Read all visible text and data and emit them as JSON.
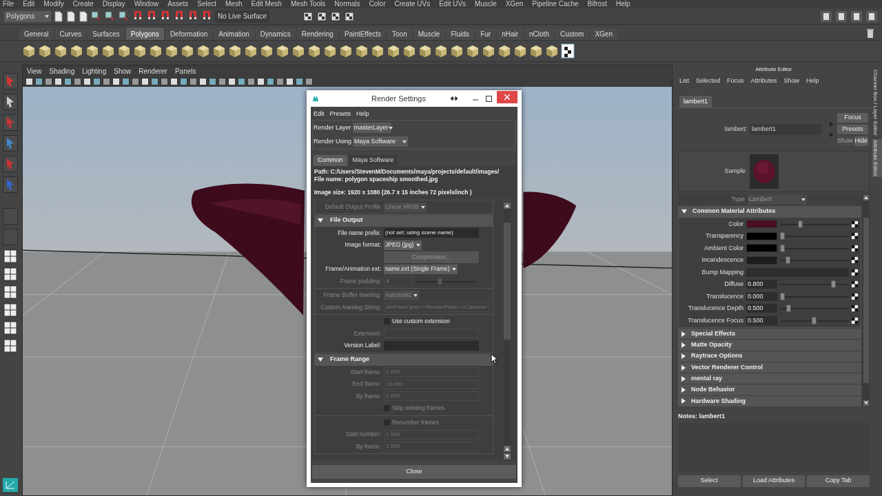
{
  "main_menu": [
    "File",
    "Edit",
    "Modify",
    "Create",
    "Display",
    "Window",
    "Assets",
    "Select",
    "Mesh",
    "Edit Mesh",
    "Mesh Tools",
    "Normals",
    "Color",
    "Create UVs",
    "Edit UVs",
    "Muscle",
    "XGen",
    "Pipeline Cache",
    "Bifrost",
    "Help"
  ],
  "status_line": {
    "menu_set": "Polygons",
    "live_surface": "No Live Surface"
  },
  "shelf_tabs": [
    {
      "label": "General",
      "selected": false
    },
    {
      "label": "Curves",
      "selected": false
    },
    {
      "label": "Surfaces",
      "selected": false
    },
    {
      "label": "Polygons",
      "selected": true
    },
    {
      "label": "Deformation",
      "selected": false
    },
    {
      "label": "Animation",
      "selected": false
    },
    {
      "label": "Dynamics",
      "selected": false
    },
    {
      "label": "Rendering",
      "selected": false
    },
    {
      "label": "PaintEffects",
      "selected": false
    },
    {
      "label": "Toon",
      "selected": false
    },
    {
      "label": "Muscle",
      "selected": false
    },
    {
      "label": "Fluids",
      "selected": false
    },
    {
      "label": "Fur",
      "selected": false
    },
    {
      "label": "nHair",
      "selected": false
    },
    {
      "label": "nCloth",
      "selected": false
    },
    {
      "label": "Custom",
      "selected": false
    },
    {
      "label": "XGen",
      "selected": false
    }
  ],
  "viewport": {
    "menu": [
      "View",
      "Shading",
      "Lighting",
      "Show",
      "Renderer",
      "Panels"
    ]
  },
  "render_settings": {
    "title": "Render Settings",
    "menu": [
      "Edit",
      "Presets",
      "Help"
    ],
    "render_layer": {
      "label": "Render Layer",
      "value": "masterLayer"
    },
    "render_using": {
      "label": "Render Using",
      "value": "Maya Software"
    },
    "tabs": [
      {
        "label": "Common",
        "selected": true
      },
      {
        "label": "Maya Software",
        "selected": false
      }
    ],
    "info": [
      "Path: C:/Users/StevenM/Documents/maya/projects/default/images/",
      "File name:  polygon spaceship smoothed.jpg",
      "Image size: 1920 x 1080 (26.7 x 15 inches 72 pixels/inch )"
    ],
    "top_rows": [
      {
        "kind": "dropdown",
        "label": "Default Output Profile",
        "value": "Linear sRGB",
        "disabled": true
      }
    ],
    "sections": [
      {
        "title": "File Output",
        "expanded": true,
        "groups": [
          [
            {
              "kind": "field",
              "label": "File name prefix:",
              "value": "(not set; using scene name)",
              "disabled": false
            },
            {
              "kind": "dropdown",
              "label": "Image format:",
              "value": "JPEG (jpg)",
              "disabled": false
            },
            {
              "kind": "button",
              "value": "Compression...",
              "disabled": true
            },
            {
              "kind": "dropdown",
              "label": "Frame/Animation ext:",
              "value": "name.ext (Single Frame)",
              "disabled": false
            },
            {
              "kind": "slider",
              "label": "Frame padding:",
              "value": "4",
              "level": 0.4,
              "disabled": true
            }
          ],
          [
            {
              "kind": "dropdown",
              "label": "Frame Buffer Naming:",
              "value": "Automatic",
              "disabled": true
            },
            {
              "kind": "field",
              "label": "Custom Naming String:",
              "value": "derPassType>:<RenderPass>.<Camera>",
              "disabled": true
            }
          ],
          [
            {
              "kind": "checkbox",
              "value": "Use custom extension",
              "checked": false,
              "disabled": false
            },
            {
              "kind": "field",
              "label": "Extension:",
              "disabled": true
            },
            {
              "kind": "field",
              "label": "Version Label:",
              "disabled": false
            }
          ]
        ]
      },
      {
        "title": "Frame Range",
        "expanded": true,
        "groups": [
          [
            {
              "kind": "field",
              "label": "Start frame:",
              "value": "1.000",
              "disabled": true
            },
            {
              "kind": "field",
              "label": "End frame:",
              "value": "10.000",
              "disabled": true
            },
            {
              "kind": "field",
              "label": "By frame:",
              "value": "1.000",
              "disabled": true
            },
            {
              "kind": "checkbox",
              "value": "Skip existing frames",
              "checked": false,
              "disabled": true
            }
          ],
          [
            {
              "kind": "checkbox",
              "value": "Renumber frames",
              "checked": false,
              "disabled": true
            },
            {
              "kind": "field",
              "label": "Start number:",
              "value": "1.000",
              "disabled": true
            },
            {
              "kind": "field",
              "label": "By frame:",
              "value": "1.000",
              "disabled": true
            }
          ]
        ]
      }
    ],
    "close": "Close"
  },
  "attribute_editor": {
    "title": "Attribute Editor",
    "menu": [
      "List",
      "Selected",
      "Focus",
      "Attributes",
      "Show",
      "Help"
    ],
    "tabs": [
      {
        "label": "lambert1",
        "selected": true
      }
    ],
    "node": {
      "label": "lambert:",
      "value": "lambert1"
    },
    "buttons": [
      {
        "label": "Focus",
        "disabled": false
      },
      {
        "label": "Presets",
        "disabled": false
      }
    ],
    "show_hide": [
      {
        "label": "Show",
        "disabled": true
      },
      {
        "label": "Hide",
        "disabled": false
      }
    ],
    "sample_label": "Sample",
    "type": {
      "label": "Type",
      "value": "Lambert"
    },
    "sections": [
      {
        "title": "Common Material Attributes",
        "expanded": true,
        "attributes": [
          {
            "kind": "color",
            "label": "Color",
            "color": "#4a0f22",
            "level": 0.29
          },
          {
            "kind": "color",
            "label": "Transparency",
            "color": "#000000",
            "level": 0.03
          },
          {
            "kind": "color",
            "label": "Ambient Color",
            "color": "#000000",
            "level": 0.03
          },
          {
            "kind": "color",
            "label": "Incandescence",
            "color": "#1c1c1c",
            "level": 0.11
          },
          {
            "kind": "map",
            "label": "Bump Mapping"
          },
          {
            "kind": "number",
            "label": "Diffuse",
            "value": "0.800",
            "level": 0.77
          },
          {
            "kind": "number",
            "label": "Translucence",
            "value": "0.000",
            "level": 0.03
          },
          {
            "kind": "number",
            "label": "Translucence Depth",
            "value": "0.500",
            "level": 0.12
          },
          {
            "kind": "number",
            "label": "Translucence Focus",
            "value": "0.500",
            "level": 0.49
          }
        ]
      },
      {
        "title": "Special Effects",
        "expanded": false
      },
      {
        "title": "Matte Opacity",
        "expanded": false
      },
      {
        "title": "Raytrace Options",
        "expanded": false
      },
      {
        "title": "Vector Renderer Control",
        "expanded": false
      },
      {
        "title": "mental ray",
        "expanded": false
      },
      {
        "title": "Node Behavior",
        "expanded": false
      },
      {
        "title": "Hardware Shading",
        "expanded": false
      }
    ],
    "notes": "Notes:  lambert1",
    "bottom_buttons": [
      "Select",
      "Load Attributes",
      "Copy Tab"
    ],
    "side_tabs": [
      "Channel Box / Layer Editor",
      "Attribute Editor"
    ]
  }
}
